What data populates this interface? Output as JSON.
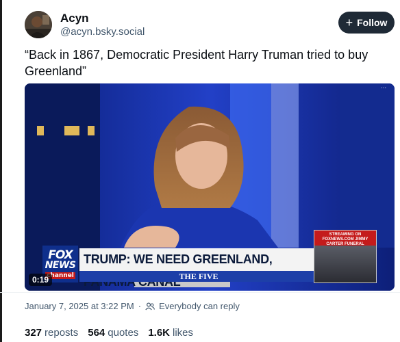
{
  "author": {
    "display_name": "Acyn",
    "handle": "@acyn.bsky.social"
  },
  "follow_button": {
    "label": "Follow",
    "icon": "plus-icon"
  },
  "post": {
    "text": "“Back in 1867, Democratic President Harry Truman tried to buy Greenland”"
  },
  "video": {
    "network_logo_line1": "FOX",
    "network_logo_line2": "NEWS",
    "network_logo_line3": "channel",
    "chyron": "TRUMP: WE NEED GREENLAND, PANAMA CANAL",
    "show_name": "THE FIVE",
    "pip_title": "STREAMING ON FOXNEWS.COM JIMMY CARTER FUNERAL",
    "duration": "0:19"
  },
  "meta": {
    "timestamp": "January 7, 2025 at 3:22 PM",
    "reply_setting": "Everybody can reply"
  },
  "stats": {
    "reposts_count": "327",
    "reposts_label": "reposts",
    "quotes_count": "564",
    "quotes_label": "quotes",
    "likes_count": "1.6K",
    "likes_label": "likes"
  }
}
